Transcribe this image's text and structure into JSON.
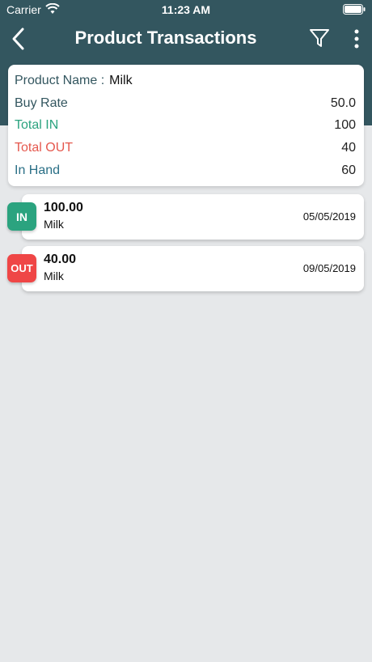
{
  "status_bar": {
    "carrier": "Carrier",
    "time": "11:23 AM"
  },
  "nav": {
    "title": "Product Transactions"
  },
  "summary": {
    "product_name_label": "Product Name :",
    "product_name_value": "Milk",
    "buy_rate_label": "Buy Rate",
    "buy_rate_value": "50.0",
    "total_in_label": "Total IN",
    "total_in_value": "100",
    "total_out_label": "Total OUT",
    "total_out_value": "40",
    "in_hand_label": "In Hand",
    "in_hand_value": "60"
  },
  "transactions": [
    {
      "type": "IN",
      "amount": "100.00",
      "product": "Milk",
      "date": "05/05/2019"
    },
    {
      "type": "OUT",
      "amount": "40.00",
      "product": "Milk",
      "date": "09/05/2019"
    }
  ],
  "colors": {
    "header_bg": "#33565f",
    "in_green": "#2ba37f",
    "out_red": "#e5584e",
    "in_hand_teal": "#2a6f86",
    "page_bg": "#e6e8ea"
  },
  "icons": {
    "back": "back-chevron-icon",
    "filter": "filter-icon",
    "more": "more-vertical-icon",
    "wifi": "wifi-icon",
    "battery": "battery-icon"
  }
}
